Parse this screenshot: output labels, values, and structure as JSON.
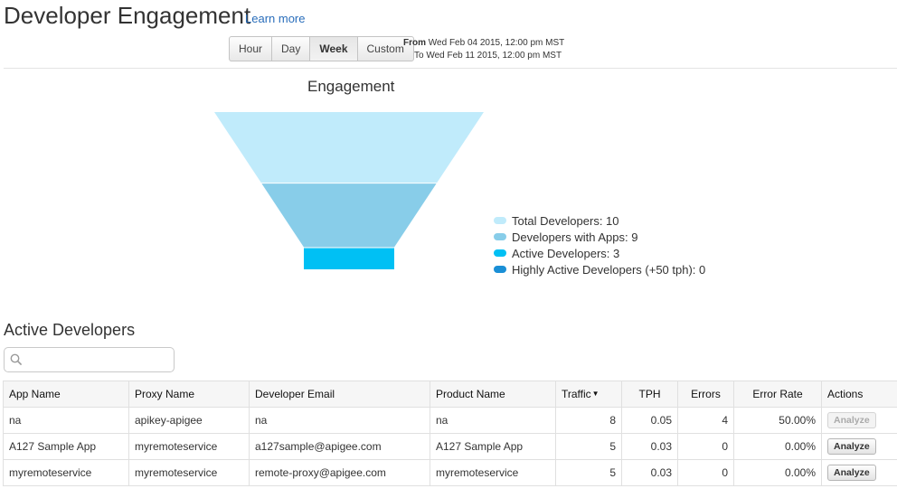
{
  "header": {
    "title": "Developer Engagement",
    "learn_more": "Learn more"
  },
  "time_range": {
    "buttons": [
      "Hour",
      "Day",
      "Week",
      "Custom"
    ],
    "selected": "Week",
    "from_label": "From",
    "from_value": "Wed Feb 04 2015, 12:00 pm MST",
    "to_label": "To",
    "to_value": "Wed Feb 11 2015, 12:00 pm MST"
  },
  "chart_data": {
    "type": "funnel",
    "title": "Engagement",
    "stages": [
      {
        "name": "Total Developers",
        "value": 10,
        "color": "#c0ebfb"
      },
      {
        "name": "Developers with Apps",
        "value": 9,
        "color": "#88cde9"
      },
      {
        "name": "Active Developers",
        "value": 3,
        "color": "#00c0f4"
      },
      {
        "name": "Highly Active Developers (+50 tph)",
        "value": 0,
        "color": "#1a8fd6"
      }
    ],
    "legend_labels": [
      "Total Developers: 10",
      "Developers with Apps: 9",
      "Active Developers: 3",
      "Highly Active Developers (+50 tph): 0"
    ],
    "legend_position": "right"
  },
  "active_developers": {
    "title": "Active Developers",
    "search_placeholder": "",
    "columns": [
      "App Name",
      "Proxy Name",
      "Developer Email",
      "Product Name",
      "Traffic",
      "TPH",
      "Errors",
      "Error Rate",
      "Actions"
    ],
    "rows": [
      {
        "app": "na",
        "proxy": "apikey-apigee",
        "email": "na",
        "product": "na",
        "traffic": "8",
        "tph": "0.05",
        "errors": "4",
        "error_rate": "50.00%",
        "action": "Analyze",
        "action_disabled": true
      },
      {
        "app": "A127 Sample App",
        "proxy": "myremoteservice",
        "email": "a127sample@apigee.com",
        "product": "A127 Sample App",
        "traffic": "5",
        "tph": "0.03",
        "errors": "0",
        "error_rate": "0.00%",
        "action": "Analyze",
        "action_disabled": false
      },
      {
        "app": "myremoteservice",
        "proxy": "myremoteservice",
        "email": "remote-proxy@apigee.com",
        "product": "myremoteservice",
        "traffic": "5",
        "tph": "0.03",
        "errors": "0",
        "error_rate": "0.00%",
        "action": "Analyze",
        "action_disabled": false
      }
    ]
  }
}
